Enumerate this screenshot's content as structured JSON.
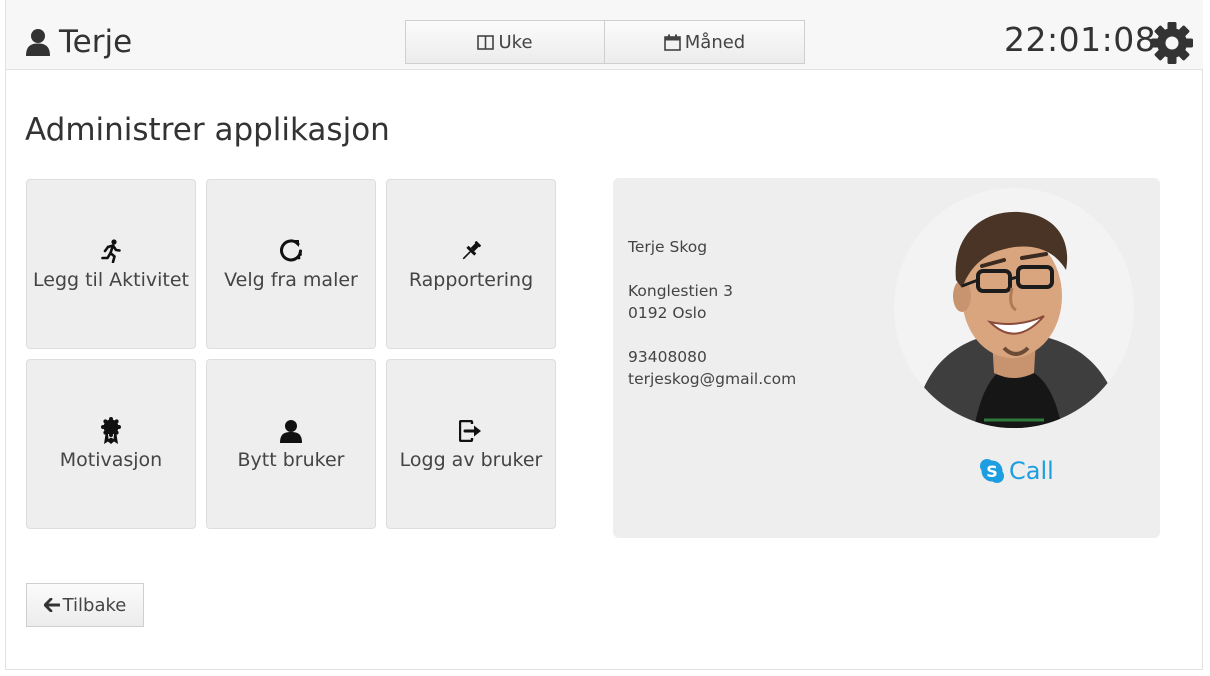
{
  "header": {
    "user_name": "Terje",
    "view_buttons": [
      {
        "label": "Uke",
        "icon": "columns-icon"
      },
      {
        "label": "Måned",
        "icon": "calendar-icon"
      }
    ],
    "clock": "22:01:08",
    "settings_icon": "gear-icon"
  },
  "main": {
    "title": "Administrer applikasjon",
    "tiles": [
      {
        "label": "Legg til Aktivitet",
        "icon": "running-icon"
      },
      {
        "label": "Velg fra maler",
        "icon": "refresh-icon"
      },
      {
        "label": "Rapportering",
        "icon": "pushpin-icon"
      },
      {
        "label": "Motivasjon",
        "icon": "award-icon"
      },
      {
        "label": "Bytt bruker",
        "icon": "user-icon"
      },
      {
        "label": "Logg av bruker",
        "icon": "logout-icon"
      }
    ]
  },
  "contact": {
    "name": "Terje Skog",
    "street": "Konglestien 3",
    "postal": "0192 Oslo",
    "phone": "93408080",
    "email": "terjeskog@gmail.com",
    "call_label": "Call",
    "call_color": "#1c9ee0"
  },
  "footer": {
    "back_label": "Tilbake"
  }
}
